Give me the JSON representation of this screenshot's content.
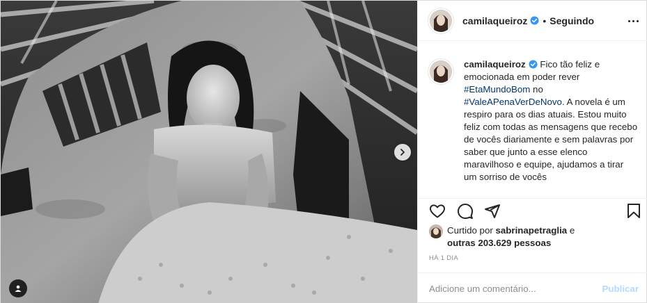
{
  "post": {
    "author": "camilaqueiroz",
    "follow_state": "Seguindo",
    "dot": "•",
    "caption": {
      "username": "camilaqueiroz",
      "text_1": " Fico tão feliz e emocionada em poder rever ",
      "hashtag_1": "#EtaMundoBom",
      "text_2": " no ",
      "hashtag_2": "#ValeAPenaVerDeNovo",
      "text_3": ". A novela é um respiro para os dias atuais. Estou muito feliz com todas as mensagens que recebo de vocês diariamente e sem palavras por saber que junto a esse elenco maravilhoso e equipe, ajudamos a tirar um sorriso de vocês"
    },
    "likes": {
      "prefix": "Curtido por ",
      "liker": "sabrinapetraglia",
      "connector": " e",
      "others": "outras 203.629 pessoas"
    },
    "time_ago": "HÁ 1 DIA",
    "comment": {
      "placeholder": "Adicione um comentário...",
      "submit_label": "Publicar"
    }
  },
  "icons": {
    "verified": "verified-badge-icon",
    "more": "more-options-icon",
    "like": "heart-icon",
    "comment": "comment-bubble-icon",
    "share": "paper-plane-icon",
    "save": "bookmark-icon",
    "next": "chevron-right-icon",
    "tag": "user-tag-icon"
  },
  "colors": {
    "verified": "#3897f0",
    "hashtag": "#00376b",
    "publish_disabled": "#b3dbff",
    "muted": "#8e8e8e"
  }
}
